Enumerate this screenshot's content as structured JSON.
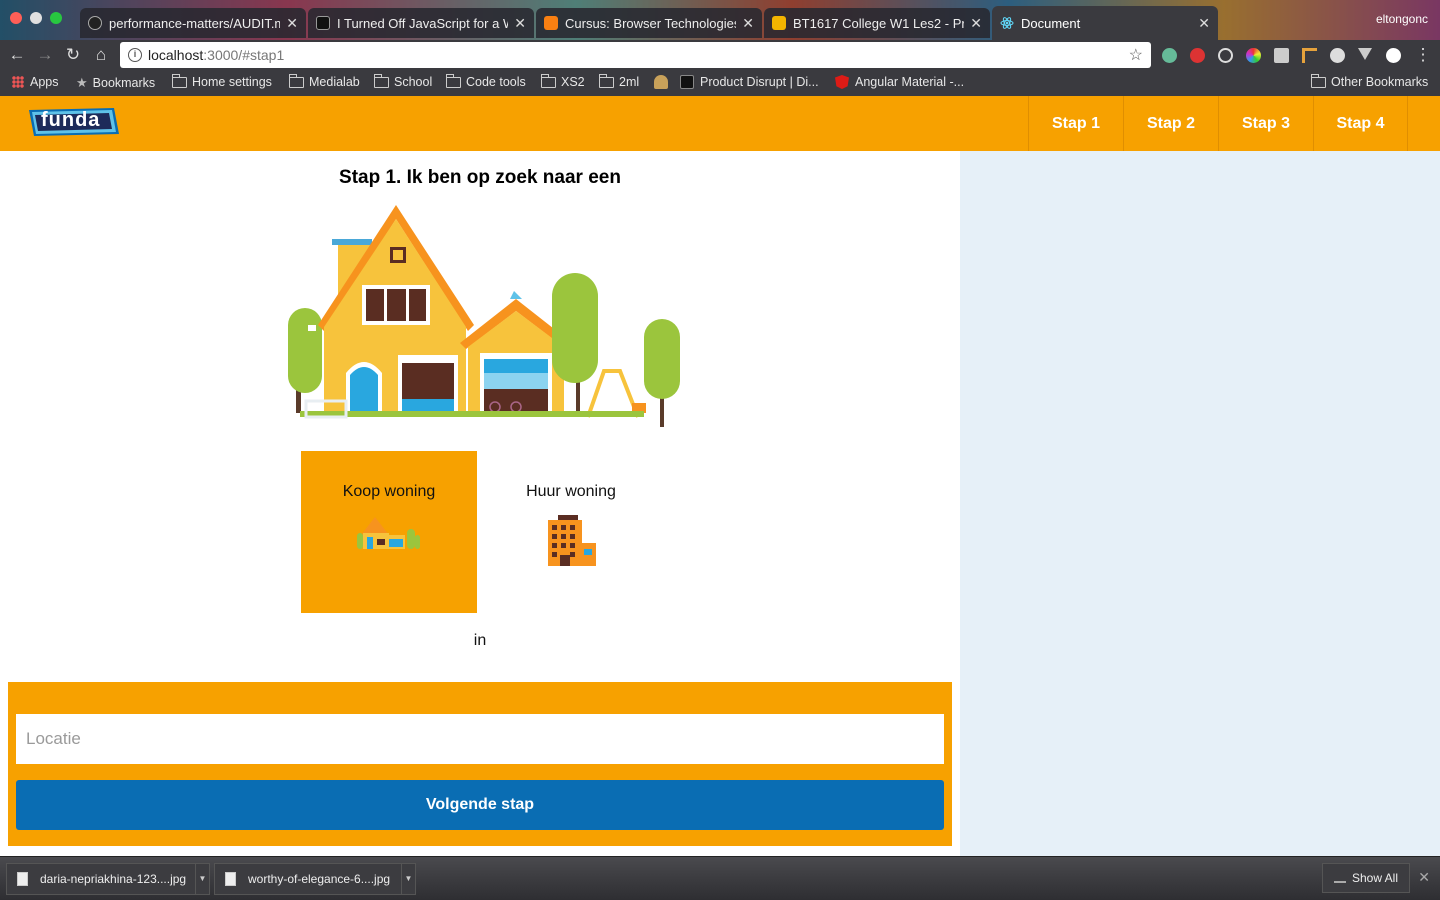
{
  "browser": {
    "tabs": [
      {
        "title": "performance-matters/AUDIT.m",
        "favicon": "github-icon",
        "color": "#222222"
      },
      {
        "title": "I Turned Off JavaScript for a W",
        "favicon": "medium-icon",
        "color": "#111111"
      },
      {
        "title": "Cursus: Browser Technologies",
        "favicon": "moodle-icon",
        "color": "#f98012"
      },
      {
        "title": "BT1617 College W1 Les2 - Pr",
        "favicon": "slides-icon",
        "color": "#f4b400"
      },
      {
        "title": "Document",
        "favicon": "react-icon",
        "color": "#61dafb"
      }
    ],
    "profile_name": "eltongonc",
    "url_host": "localhost",
    "url_path": ":3000/#stap1",
    "bookmarks": [
      {
        "label": "Apps",
        "icon": "apps-icon"
      },
      {
        "label": "Bookmarks",
        "icon": "star-icon"
      },
      {
        "label": "Home settings",
        "icon": "folder-icon"
      },
      {
        "label": "Medialab",
        "icon": "folder-icon"
      },
      {
        "label": "School",
        "icon": "folder-icon"
      },
      {
        "label": "Code tools",
        "icon": "folder-icon"
      },
      {
        "label": "XS2",
        "icon": "folder-icon"
      },
      {
        "label": "2ml",
        "icon": "folder-icon"
      },
      {
        "label": "Product Disrupt | Di...",
        "icon": "pd-icon"
      },
      {
        "label": "Angular Material -...",
        "icon": "angular-icon"
      },
      {
        "label": "Other Bookmarks",
        "icon": "folder-icon"
      }
    ]
  },
  "header": {
    "logo_text": "funda",
    "steps": [
      "Stap 1",
      "Stap 2",
      "Stap 3",
      "Stap 4"
    ]
  },
  "main": {
    "heading": "Stap 1. Ik ben op zoek naar een",
    "options": [
      {
        "label": "Koop woning",
        "selected": true
      },
      {
        "label": "Huur woning",
        "selected": false
      }
    ],
    "in_label": "in",
    "location_placeholder": "Locatie",
    "next_button": "Volgende stap"
  },
  "downloads": {
    "items": [
      "daria-nepriakhina-123....jpg",
      "worthy-of-elegance-6....jpg"
    ],
    "show_all": "Show All"
  },
  "colors": {
    "brand_orange": "#f7a100",
    "button_blue": "#0a6db3",
    "sidebar_bg": "#e6f0f8"
  }
}
